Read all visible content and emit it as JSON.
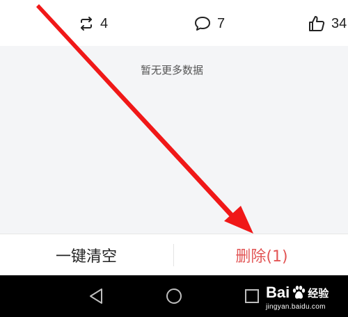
{
  "stats": {
    "repost_count": "4",
    "comment_count": "7",
    "like_count": "34"
  },
  "content": {
    "empty_text": "暂无更多数据"
  },
  "actions": {
    "clear_all_label": "一键清空",
    "delete_label": "删除(1)"
  },
  "watermark": {
    "logo_text": "Bai",
    "logo_suffix": "经验",
    "url": "jingyan.baidu.com"
  },
  "colors": {
    "delete_text": "#e25555",
    "annotation_arrow": "#f01818",
    "content_background": "#f4f5f7"
  },
  "icons": {
    "repost": "repost-icon",
    "comment": "comment-icon",
    "like": "thumbs-up-icon",
    "nav_back": "triangle-back-icon",
    "nav_home": "circle-home-icon",
    "nav_recent": "square-recent-icon"
  }
}
